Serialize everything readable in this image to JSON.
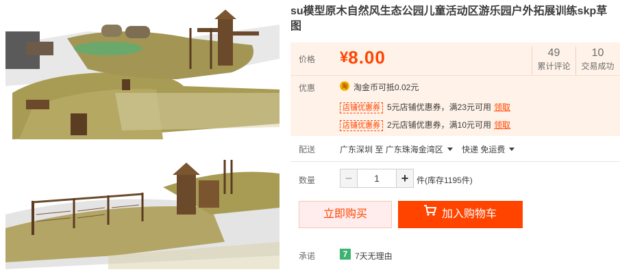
{
  "product": {
    "title": "su模型原木自然风生态公园儿童活动区游乐园户外拓展训练skp草图"
  },
  "images": [
    {
      "alt": "playground-rendering-top"
    },
    {
      "alt": "playground-rendering-bottom"
    }
  ],
  "price": {
    "label": "价格",
    "currency": "¥",
    "amount": "8.00",
    "color": "#ff4400"
  },
  "stats": {
    "reviews_count": "49",
    "reviews_label": "累计评论",
    "sales_count": "10",
    "sales_label": "交易成功"
  },
  "promo": {
    "label": "优惠",
    "coin_icon": "淘",
    "coin_text": "淘金币可抵0.02元",
    "coupons": [
      {
        "tag": "店铺优惠券",
        "desc": "5元店铺优惠券，满23元可用",
        "action": "领取"
      },
      {
        "tag": "店铺优惠券",
        "desc": "2元店铺优惠券，满10元可用",
        "action": "领取"
      }
    ]
  },
  "shipping": {
    "label": "配送",
    "from": "广东深圳 至",
    "to": "广东珠海金湾区",
    "method": "快递 免运费"
  },
  "quantity": {
    "label": "数量",
    "minus": "−",
    "value": "1",
    "plus": "+",
    "stock": "件(库存1195件)"
  },
  "actions": {
    "buy_now": "立即购买",
    "add_to_cart": "加入购物车"
  },
  "promise": {
    "label": "承诺",
    "badge": "7",
    "text": "7天无理由"
  },
  "colors": {
    "accent": "#ff4400",
    "price_bg": "#fff2e8",
    "buy_now_bg": "#ffeded",
    "badge_green": "#3cb371"
  }
}
